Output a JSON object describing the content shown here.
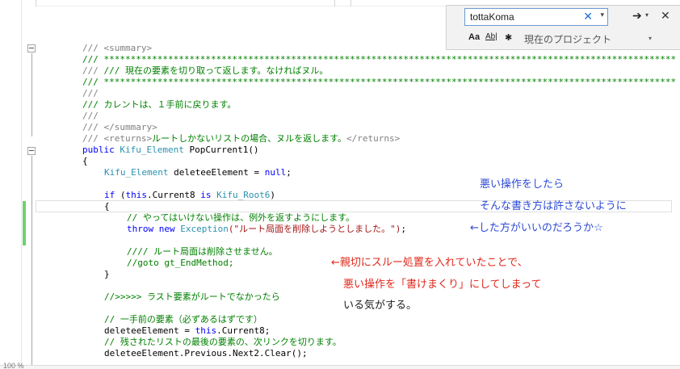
{
  "find": {
    "query": "tottaKoma",
    "clear_glyph": "✕",
    "dropdown_glyph": "▾",
    "next_glyph": "➔",
    "close_glyph": "✕",
    "match_case": "Aa",
    "whole_word": "Ab|",
    "regex": "✱",
    "scope": "現在のプロジェクト"
  },
  "code": {
    "l1": "/// <summary>",
    "l2": "/// ************************************************************************************************************************",
    "l3": "/// 現在の要素を切り取って返します。なければヌル。",
    "l4": "/// ************************************************************************************************************************",
    "l5": "///",
    "l6": "/// カレントは、１手前に戻ります。",
    "l7": "///",
    "l8": "/// </summary>",
    "l9_pre": "/// <returns>",
    "l9_mid": "ルートしかないリストの場合、ヌルを返します。",
    "l9_post": "</returns>",
    "l10_kw": "public ",
    "l10_type": "Kifu_Element",
    "l10_rest": " PopCurrent1()",
    "l11": "{",
    "l12_type": "Kifu_Element",
    "l12_rest": " deleteeElement = ",
    "l12_kw": "null",
    "l12_end": ";",
    "l13_if": "if",
    "l13_a": " (",
    "l13_this": "this",
    "l13_b": ".Current8 ",
    "l13_is": "is",
    "l13_c": " ",
    "l13_type": "Kifu_Root6",
    "l13_d": ")",
    "l14": "{",
    "l15": "// やってはいけない操作は、例外を返すようにします。",
    "l16_throw": "throw",
    "l16_sp": " ",
    "l16_new": "new",
    "l16_sp2": " ",
    "l16_type": "Exception",
    "l16_str": "(\"ルート局面を削除しようとしました。\")",
    "l16_end": ";",
    "l17": "//// ルート局面は削除させません。",
    "l18": "//goto gt_EndMethod;",
    "l19": "}",
    "l20": "//>>>>> ラスト要素がルートでなかったら",
    "l21": "// 一手前の要素（必ずあるはずです）",
    "l22_a": "deleteeElement = ",
    "l22_this": "this",
    "l22_b": ".Current8;",
    "l23": "// 残されたリストの最後の要素の、次リンクを切ります。",
    "l24": "deleteeElement.Previous.Next2.Clear();"
  },
  "annotations": {
    "a1": "悪い操作をしたら",
    "a2": "そんな書き方は許さないように",
    "a3": "←した方がいいのだろうか☆",
    "b1": "←親切にスルー処置を入れていたことで、",
    "b2": "悪い操作を「書けまくり」にしてしまって",
    "b3": "いる気がする。"
  },
  "status": {
    "zoom": "100 %"
  },
  "colors": {
    "comment": "#008000",
    "keyword": "#0000ff",
    "type": "#2b91af",
    "string": "#a31515",
    "annotation_blue": "#2e4bd6",
    "annotation_red": "#e0281c",
    "change_bar": "#6fd16f"
  }
}
